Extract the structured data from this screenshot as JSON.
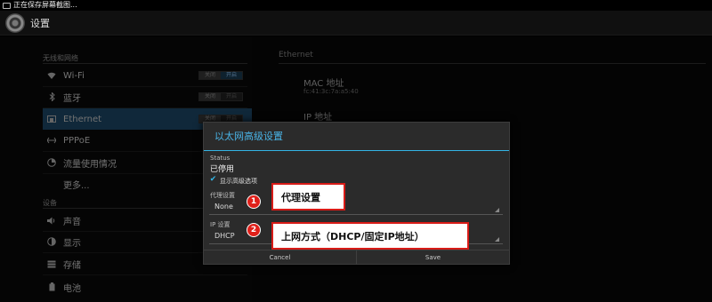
{
  "status_bar": {
    "text": "正在保存屏幕截图..."
  },
  "action_bar": {
    "title": "设置"
  },
  "left_pane": {
    "section_wireless": "无线和网络",
    "items_wireless": [
      {
        "id": "wifi",
        "icon": "wifi-icon",
        "label": "Wi-Fi",
        "toggle_off": "关闭",
        "toggle_on": "开启"
      },
      {
        "id": "bluetooth",
        "icon": "bluetooth-icon",
        "label": "蓝牙",
        "toggle_off": "关闭",
        "toggle_on": "开启"
      },
      {
        "id": "ethernet",
        "icon": "ethernet-icon",
        "label": "Ethernet",
        "toggle_off": "关闭",
        "toggle_on": "开启"
      },
      {
        "id": "pppoe",
        "icon": "pppoe-icon",
        "label": "PPPoE",
        "toggle_off": "关闭",
        "toggle_on": "开启"
      },
      {
        "id": "data-usage",
        "icon": "data-usage-icon",
        "label": "流量使用情况"
      },
      {
        "id": "more",
        "icon": "",
        "label": "更多..."
      }
    ],
    "section_device": "设备",
    "items_device": [
      {
        "id": "sound",
        "icon": "sound-icon",
        "label": "声音"
      },
      {
        "id": "display",
        "icon": "display-icon",
        "label": "显示"
      },
      {
        "id": "storage",
        "icon": "storage-icon",
        "label": "存储"
      },
      {
        "id": "battery",
        "icon": "battery-icon",
        "label": "电池"
      }
    ]
  },
  "right_pane": {
    "title": "Ethernet",
    "mac_label": "MAC 地址",
    "mac_value": "fc:41:3c:7a:a5:40",
    "ip_label": "IP 地址"
  },
  "dialog": {
    "title": "以太网高级设置",
    "status_label": "Status",
    "status_value": "已停用",
    "show_advanced_label": "显示高级选项",
    "show_advanced_checked": true,
    "proxy_label": "代理设置",
    "proxy_value": "None",
    "ip_settings_label": "IP 设置",
    "ip_settings_value": "DHCP",
    "cancel_label": "Cancel",
    "save_label": "Save"
  },
  "annotations": [
    {
      "number": "1",
      "text": "代理设置"
    },
    {
      "number": "2",
      "text": "上网方式（DHCP/固定IP地址）"
    }
  ],
  "colors": {
    "accent": "#33b5e5",
    "selected_row": "#1e4a6a",
    "callout_border": "#d81b17",
    "badge": "#e0201a"
  }
}
